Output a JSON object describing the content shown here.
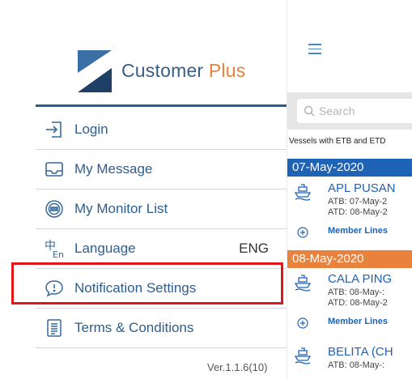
{
  "brand": {
    "name_main": "Customer ",
    "name_accent": "Plus",
    "accent_color": "#e8823c",
    "primary_color": "#2d5d8f"
  },
  "menu": {
    "items": [
      {
        "label": "Login",
        "icon": "login-icon"
      },
      {
        "label": "My Message",
        "icon": "inbox-icon"
      },
      {
        "label": "My Monitor List",
        "icon": "monitor-icon"
      },
      {
        "label": "Language",
        "icon": "language-icon",
        "value": "ENG"
      },
      {
        "label": "Notification Settings",
        "icon": "notification-icon"
      },
      {
        "label": "Terms & Conditions",
        "icon": "document-icon"
      }
    ],
    "highlighted": "Notification Settings",
    "highlight_color": "#e3151c"
  },
  "version": "Ver.1.1.6(10)",
  "main": {
    "menu_icon": "hamburger-icon",
    "search_placeholder": "Search",
    "caption": "Vessels with ETB and ETD",
    "groups": [
      {
        "date": "07-May-2020",
        "color": "#1e63b6",
        "vessels": [
          {
            "name": "APL PUSAN",
            "atb": "ATB: 07-May-2",
            "atd": "ATD: 08-May-2",
            "member": "Member Lines"
          }
        ]
      },
      {
        "date": "08-May-2020",
        "color": "#e8823c",
        "vessels": [
          {
            "name": "CALA PING",
            "atb": "ATB: 08-May-:",
            "atd": "ATD: 08-May-2",
            "member": "Member Lines"
          },
          {
            "name": "BELITA (CH",
            "atb": "ATB: 08-May-:"
          }
        ]
      }
    ]
  }
}
